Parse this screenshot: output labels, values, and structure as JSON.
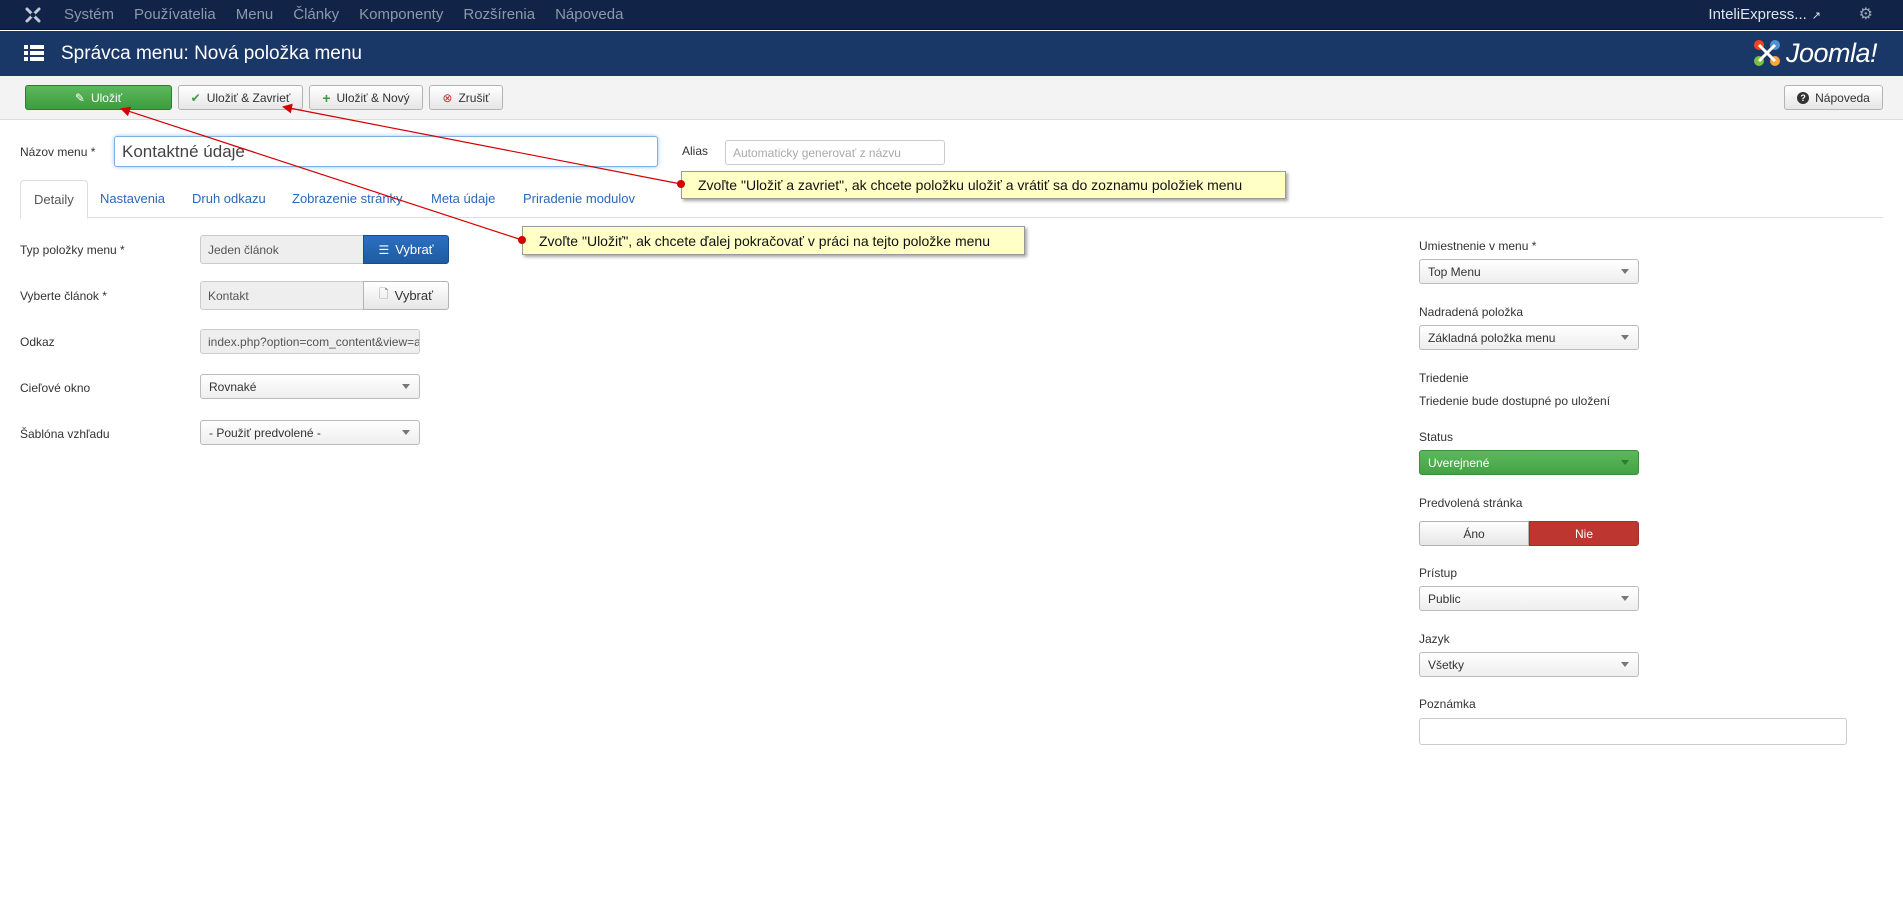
{
  "topnav": {
    "items": [
      "Systém",
      "Používatelia",
      "Menu",
      "Články",
      "Komponenty",
      "Rozšírenia",
      "Nápoveda"
    ],
    "site": "InteliExpress...",
    "logo_icon": "joomla-icon",
    "gear_icon": "gear-icon"
  },
  "header": {
    "title": "Správca menu: Nová položka menu",
    "brand": "Joomla!"
  },
  "toolbar": {
    "save": "Uložiť",
    "save_close": "Uložiť & Zavrieť",
    "save_new": "Uložiť & Nový",
    "cancel": "Zrušiť",
    "help": "Nápoveda"
  },
  "form": {
    "title_label": "Názov menu *",
    "title_value": "Kontaktné údaje",
    "alias_label": "Alias",
    "alias_placeholder": "Automaticky generovať z názvu"
  },
  "tabs": [
    "Detaily",
    "Nastavenia",
    "Druh odkazu",
    "Zobrazenie stránky",
    "Meta údaje",
    "Priradenie modulov"
  ],
  "details": {
    "type_label": "Typ položky menu *",
    "type_value": "Jeden článok",
    "type_button": "Vybrať",
    "article_label": "Vyberte článok *",
    "article_value": "Kontakt",
    "article_button": "Vybrať",
    "link_label": "Odkaz",
    "link_value": "index.php?option=com_content&view=article",
    "target_label": "Cieľové okno",
    "target_value": "Rovnaké",
    "template_label": "Šablóna vzhľadu",
    "template_value": "- Použiť predvolené -"
  },
  "sidebar": {
    "menu_label": "Umiestnenie v menu *",
    "menu_value": "Top Menu",
    "parent_label": "Nadradená položka",
    "parent_value": "Základná položka menu",
    "order_label": "Triedenie",
    "order_text": "Triedenie bude dostupné po uložení",
    "status_label": "Status",
    "status_value": "Uverejnené",
    "home_label": "Predvolená stránka",
    "home_yes": "Áno",
    "home_no": "Nie",
    "access_label": "Prístup",
    "access_value": "Public",
    "language_label": "Jazyk",
    "language_value": "Všetky",
    "note_label": "Poznámka",
    "note_value": ""
  },
  "callouts": {
    "save_close_hint": "Zvoľte \"Uložiť a zavriet\", ak chcete položku uložiť a vrátiť sa do zoznamu položiek menu",
    "save_hint": "Zvoľte \"Uložiť\", ak chcete ďalej pokračovať v práci na tejto položke menu"
  },
  "colors": {
    "topnav_bg": "#112347",
    "header_bg": "#1a3867",
    "save_green": "#46a546",
    "choose_blue": "#2662ab",
    "no_red": "#bd362f",
    "callout_bg": "#ffffc6",
    "arrow_red": "#d40000",
    "tab_link": "#2a69b8"
  }
}
